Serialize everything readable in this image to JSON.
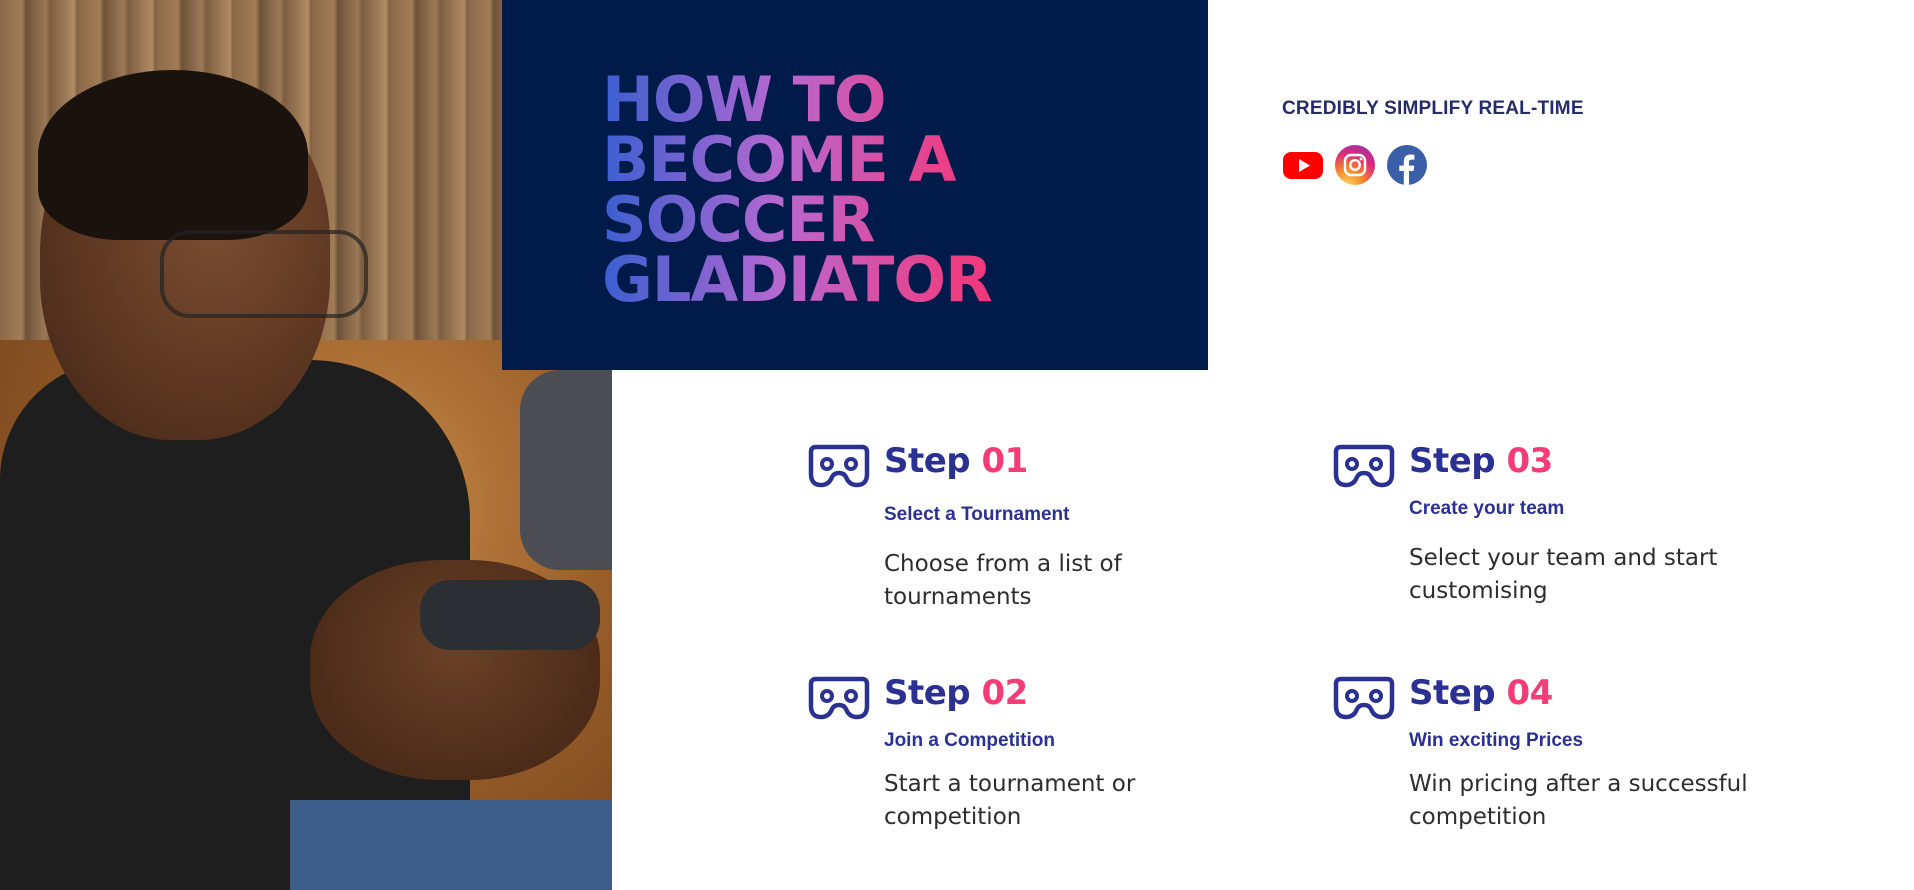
{
  "hero": {
    "title": "HOW TO\nBECOME A\nSOCCER\nGLADIATOR"
  },
  "tagline": "CREDIBLY SIMPLIFY REAL-TIME",
  "social": [
    {
      "icon": "youtube-icon",
      "color": "#ff0000"
    },
    {
      "icon": "instagram-icon",
      "color": "#e1306c"
    },
    {
      "icon": "facebook-icon",
      "color": "#3b5998"
    }
  ],
  "steps": [
    {
      "word": "Step",
      "number": "01",
      "subtitle": "Select a Tournament",
      "description": "Choose from a list of tournaments"
    },
    {
      "word": "Step",
      "number": "02",
      "subtitle": "Join a Competition",
      "description": "Start a tournament or competition"
    },
    {
      "word": "Step",
      "number": "03",
      "subtitle": "Create your team",
      "description": "Select your team and start customising"
    },
    {
      "word": "Step",
      "number": "04",
      "subtitle": "Win exciting Prices",
      "description": "Win pricing after a successful competition"
    }
  ],
  "colors": {
    "navy": "#001b4a",
    "heading_blue": "#2a3192",
    "accent_pink": "#f23d78"
  }
}
